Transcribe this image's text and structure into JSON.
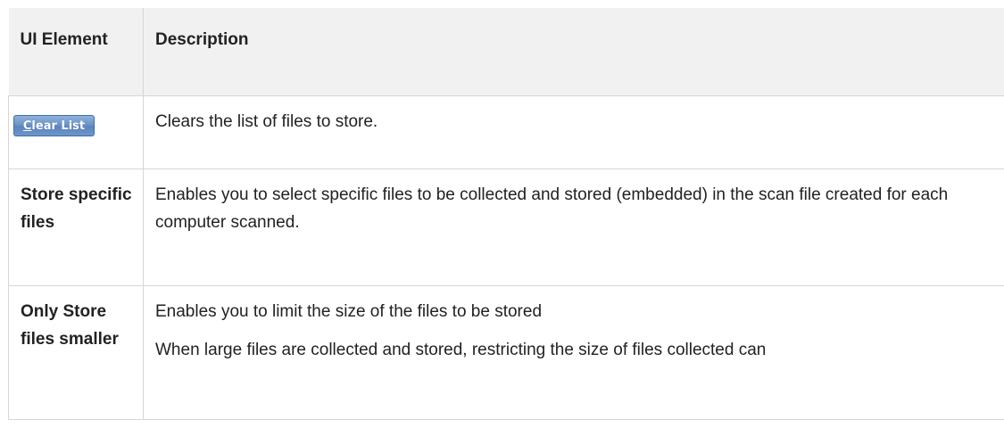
{
  "table": {
    "header": {
      "element": "UI Element",
      "description": "Description"
    },
    "rows": [
      {
        "element_button": {
          "mnemonic": "C",
          "rest": "lear List"
        },
        "description": [
          "Clears the list of files to store."
        ]
      },
      {
        "element": "Store specific files",
        "description": [
          "Enables you to select specific files to be collected and stored (embedded) in the scan file created for each computer scanned."
        ]
      },
      {
        "element": "Only Store files smaller",
        "description": [
          "Enables you to limit the size of the files to be stored",
          "When large files are collected and stored, restricting the size of files collected can"
        ]
      }
    ]
  }
}
